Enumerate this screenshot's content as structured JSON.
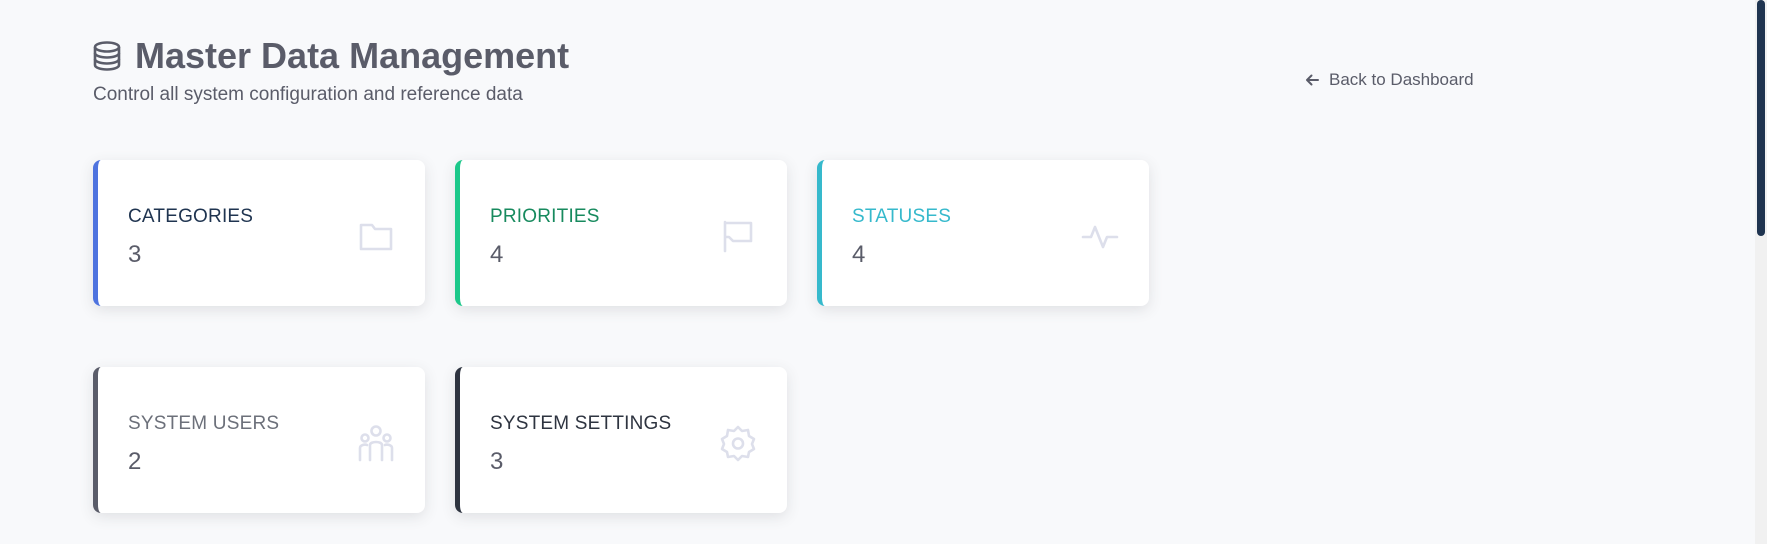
{
  "header": {
    "title": "Master Data Management",
    "subtitle": "Control all system configuration and reference data",
    "icon": "database-icon"
  },
  "back_link": {
    "label": "Back to Dashboard",
    "icon": "arrow-left-icon"
  },
  "cards": [
    {
      "label": "CATEGORIES",
      "value": "3",
      "icon": "folder-icon",
      "accent": "#4e73df",
      "label_color": "#1f3450"
    },
    {
      "label": "PRIORITIES",
      "value": "4",
      "icon": "flag-icon",
      "accent": "#1cc88a",
      "label_color": "#178a5e"
    },
    {
      "label": "STATUSES",
      "value": "4",
      "icon": "activity-icon",
      "accent": "#36b9cc",
      "label_color": "#36b9cc"
    },
    {
      "label": "SYSTEM USERS",
      "value": "2",
      "icon": "users-icon",
      "accent": "#5a5c69",
      "label_color": "#6c707a"
    },
    {
      "label": "SYSTEM SETTINGS",
      "value": "3",
      "icon": "gear-icon",
      "accent": "#2e3440",
      "label_color": "#2e3440"
    }
  ]
}
